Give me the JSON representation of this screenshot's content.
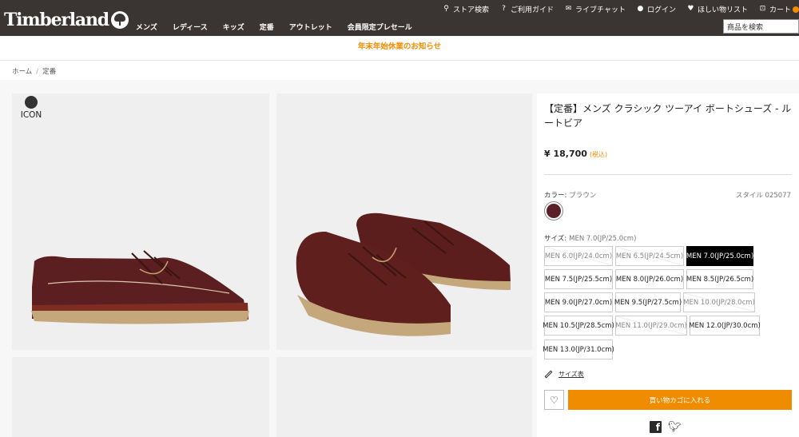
{
  "header": {
    "logo_text": "Timberland",
    "main_nav": [
      "メンズ",
      "レディース",
      "キッズ",
      "定番",
      "アウトレット",
      "会員限定プレセール"
    ],
    "util_nav": [
      {
        "label": "ストア検索",
        "icon": "location-pin-icon"
      },
      {
        "label": "ご利用ガイド",
        "icon": "help-circle-icon"
      },
      {
        "label": "ライブチャット",
        "icon": "chat-icon"
      },
      {
        "label": "ログイン",
        "icon": "user-icon"
      },
      {
        "label": "ほしい物リスト",
        "icon": "heart-icon"
      },
      {
        "label": "カート",
        "icon": "cart-icon"
      }
    ],
    "search_placeholder": "商品を検索"
  },
  "notice": "年末年始休業のお知らせ",
  "breadcrumb": [
    "ホーム",
    "定番"
  ],
  "gallery": {
    "badge_text": "ICON"
  },
  "product": {
    "title": "【定番】メンズ クラシック ツーアイ ボートシューズ - ルートビア",
    "price": "¥ 18,700",
    "tax_note": "(税込)",
    "color_label": "カラー:",
    "color_value": "ブラウン",
    "style_label": "スタイル",
    "style_number": "025077",
    "size_label": "サイズ:",
    "size_value": "MEN 7.0(JP/25.0cm)",
    "sizes": [
      {
        "label": "MEN 6.0(JP/24.0cm)",
        "available": false
      },
      {
        "label": "MEN 6.5(JP/24.5cm)",
        "available": false
      },
      {
        "label": "MEN 7.0(JP/25.0cm)",
        "available": true,
        "selected": true
      },
      {
        "label": "MEN 7.5(JP/25.5cm)",
        "available": true
      },
      {
        "label": "MEN 8.0(JP/26.0cm)",
        "available": true
      },
      {
        "label": "MEN 8.5(JP/26.5cm)",
        "available": true
      },
      {
        "label": "MEN 9.0(JP/27.0cm)",
        "available": true
      },
      {
        "label": "MEN 9.5(JP/27.5cm)",
        "available": true
      },
      {
        "label": "MEN 10.0(JP/28.0cm)",
        "available": false
      },
      {
        "label": "MEN 10.5(JP/28.5cm)",
        "available": true
      },
      {
        "label": "MEN 11.0(JP/29.0cm)",
        "available": false
      },
      {
        "label": "MEN 12.0(JP/30.0cm)",
        "available": true
      },
      {
        "label": "MEN 13.0(JP/31.0cm)",
        "available": true
      }
    ],
    "size_guide": "サイズ表",
    "add_to_cart": "買い物カゴに入れる",
    "swatch_color": "#5a1f28"
  },
  "colors": {
    "header_bg": "#3a3433",
    "accent": "#f08c00"
  }
}
